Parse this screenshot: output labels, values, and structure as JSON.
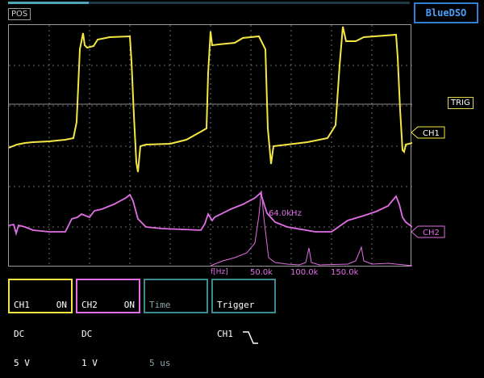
{
  "header": {
    "position_label": "POS",
    "brand": "BlueDSO",
    "position_indicator_fraction": 0.2
  },
  "markers": {
    "trigger": "TRIG",
    "ch1": "CH1",
    "ch2": "CH2"
  },
  "fft": {
    "peak_label": "64.0kHz",
    "axis_label": "f[Hz]",
    "tick_labels": [
      "50.0k",
      "100.0k",
      "150.0k"
    ]
  },
  "channels": {
    "ch1": {
      "name": "CH1",
      "state": "ON",
      "coupling": "DC",
      "scale": "5 V"
    },
    "ch2": {
      "name": "CH2",
      "state": "ON",
      "coupling": "DC",
      "scale": "1 V"
    }
  },
  "timebase": {
    "title": "Time",
    "value": "5 us"
  },
  "trigger": {
    "title": "Trigger",
    "source": "CH1"
  },
  "colors": {
    "ch1": "#f4e742",
    "ch2": "#e26ee6",
    "brand": "#2f7fd6",
    "panel_border": "#3e8a92",
    "grid": "#8a8a8a"
  }
}
